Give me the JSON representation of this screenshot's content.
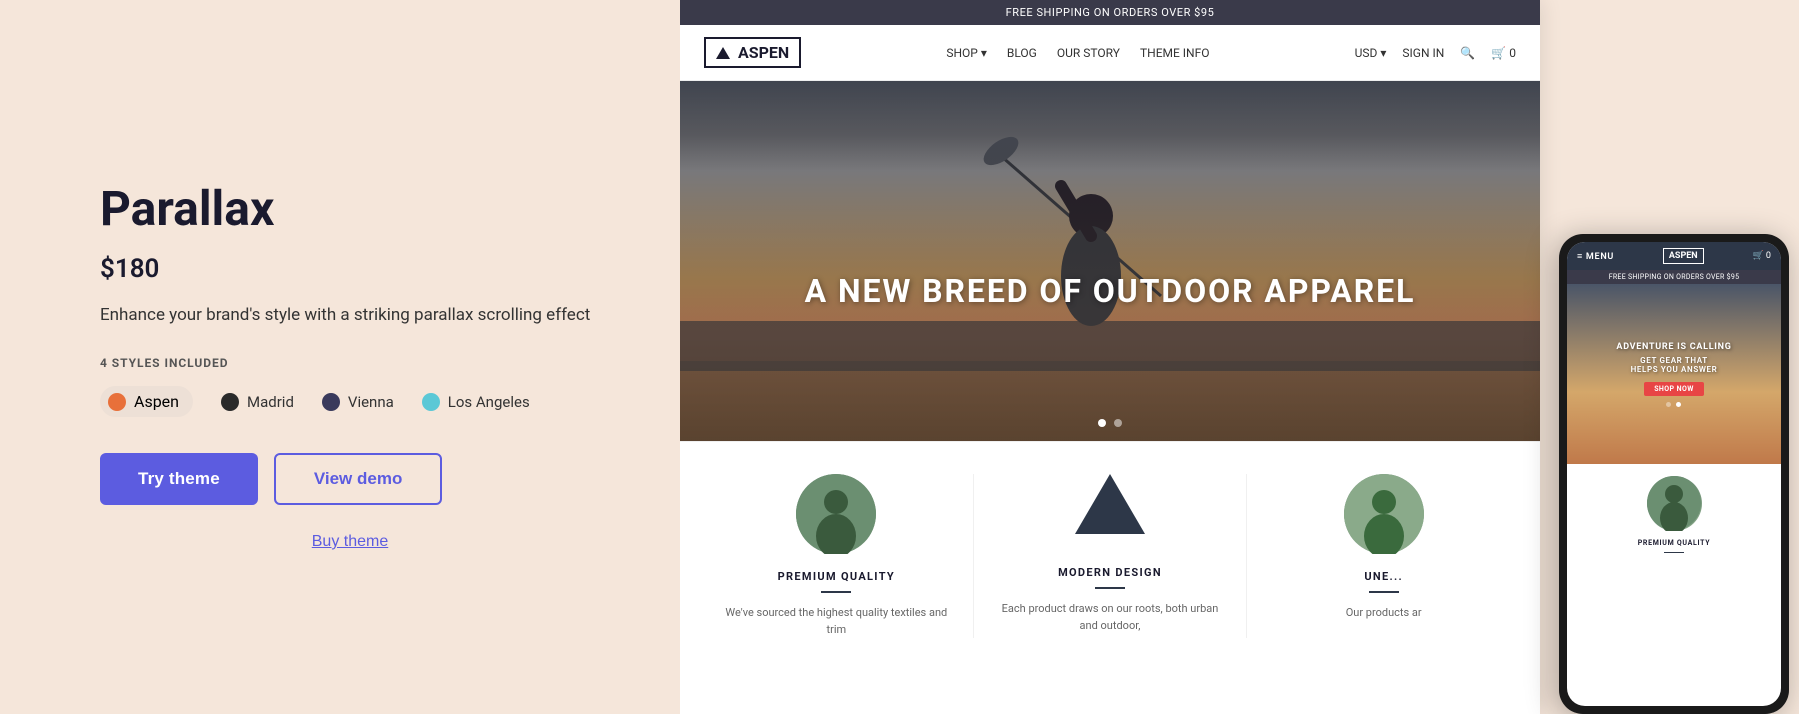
{
  "left": {
    "title": "Parallax",
    "price": "$180",
    "description": "Enhance your brand's style with a striking parallax scrolling effect",
    "styles_label": "4 STYLES INCLUDED",
    "styles": [
      {
        "id": "aspen",
        "label": "Aspen",
        "color": "orange",
        "active": true
      },
      {
        "id": "madrid",
        "label": "Madrid",
        "color": "dark",
        "active": false
      },
      {
        "id": "vienna",
        "label": "Vienna",
        "color": "navy",
        "active": false
      },
      {
        "id": "los-angeles",
        "label": "Los Angeles",
        "color": "teal",
        "active": false
      }
    ],
    "try_theme_label": "Try theme",
    "view_demo_label": "View demo",
    "buy_theme_label": "Buy theme"
  },
  "store_preview": {
    "top_bar_text": "FREE SHIPPING ON ORDERS OVER $95",
    "logo_text": "ASPEN",
    "nav_links": [
      "SHOP ▾",
      "BLOG",
      "OUR STORY",
      "THEME INFO"
    ],
    "nav_right": [
      "USD ▾",
      "SIGN IN",
      "🔍",
      "🛒 0"
    ],
    "hero_text": "A NEW BREED OF OUTDOOR APPAREL",
    "hero_dots": [
      true,
      false
    ],
    "features": [
      {
        "icon_type": "person",
        "title": "PREMIUM QUALITY",
        "desc": "We've sourced the highest quality textiles and trim"
      },
      {
        "icon_type": "mountain",
        "title": "MODERN DESIGN",
        "desc": "Each product draws on our roots, both urban and outdoor,"
      },
      {
        "icon_type": "partial",
        "title": "UNE...",
        "desc": "Our products ar"
      }
    ]
  },
  "mobile_preview": {
    "menu_text": "≡ MENU",
    "logo_text": "ASPEN",
    "cart_text": "🛒 0",
    "banner_text": "FREE SHIPPING ON ORDERS OVER $95",
    "hero_line1": "ADVENTURE IS CALLING",
    "hero_line2": "GET GEAR THAT\nHELPS YOU ANSWER",
    "shop_btn": "SHOP NOW",
    "feature_title": "PREMIUM QUALITY"
  },
  "colors": {
    "background": "#f5e6da",
    "title": "#1a1a2e",
    "price": "#1a1a2e",
    "description": "#333333",
    "btn_primary_bg": "#5c5ce0",
    "btn_primary_text": "#ffffff",
    "btn_secondary_border": "#5c5ce0",
    "btn_secondary_text": "#5c5ce0",
    "buy_link": "#5c5ce0"
  }
}
